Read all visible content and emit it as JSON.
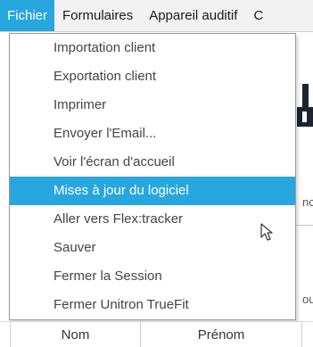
{
  "menubar": {
    "items": [
      "Fichier",
      "Formulaires",
      "Appareil auditif",
      "C"
    ],
    "active_index": 0
  },
  "background": {
    "partial_texts": [
      "nc",
      "ou"
    ]
  },
  "menu": {
    "items": [
      "Importation client",
      "Exportation client",
      "Imprimer",
      "Envoyer l'Email...",
      "Voir l'écran d'accueil",
      "Mises à jour du logiciel",
      "Aller vers Flex:tracker",
      "Sauver",
      "Fermer la Session",
      "Fermer Unitron TrueFit"
    ],
    "highlighted_index": 5
  },
  "table": {
    "headers": [
      "Nom",
      "Prénom"
    ]
  },
  "colors": {
    "accent": "#27a7de",
    "menubar_bg": "#f2f2f2"
  },
  "icons": {
    "cursor": "mouse-pointer-icon"
  }
}
